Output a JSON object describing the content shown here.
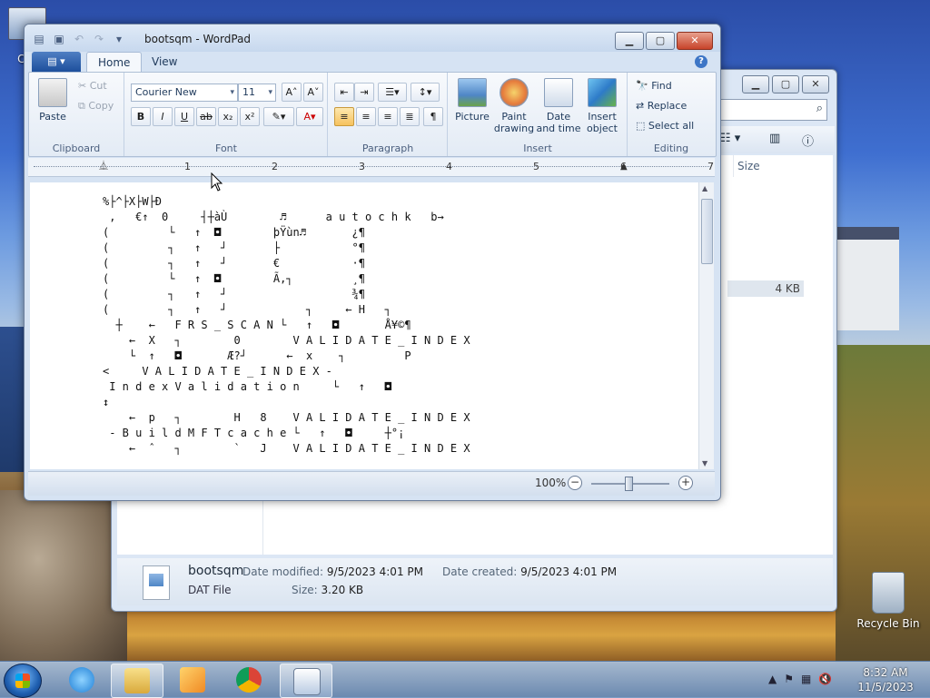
{
  "desktop": {
    "computer_label": "Co",
    "recycle_label": "Recycle Bin"
  },
  "explorer": {
    "column_size": "Size",
    "row_size": "4 KB",
    "search_icon": "search-icon",
    "details": {
      "file_name": "bootsqm",
      "file_type": "DAT File",
      "date_modified_label": "Date modified:",
      "date_modified_value": "9/5/2023 4:01 PM",
      "date_created_label": "Date created:",
      "date_created_value": "9/5/2023 4:01 PM",
      "size_label": "Size:",
      "size_value": "3.20 KB"
    }
  },
  "wordpad": {
    "title": "bootsqm - WordPad",
    "tabs": [
      "Home",
      "View"
    ],
    "clipboard": {
      "paste": "Paste",
      "cut": "Cut",
      "copy": "Copy",
      "label": "Clipboard"
    },
    "font": {
      "family": "Courier New",
      "size": "11",
      "label": "Font"
    },
    "paragraph": {
      "label": "Paragraph"
    },
    "insert": {
      "picture": "Picture",
      "paint": "Paint drawing",
      "datetime": "Date and time",
      "object": "Insert object",
      "label": "Insert"
    },
    "editing": {
      "find": "Find",
      "replace": "Replace",
      "select_all": "Select all",
      "label": "Editing"
    },
    "ruler_ticks": [
      "1",
      "2",
      "3",
      "4",
      "5",
      "6",
      "7"
    ],
    "zoom": "100%",
    "document_lines": [
      "%├^├X├W├Ð",
      " ,   €↑  0     ┤┼àÙ        ♬      a u t o c h k   b→",
      "(         └   ↑  ◘        þŸùn♬       ¿¶",
      "(         ┐   ↑   ┘       ├           °¶",
      "(         ┐   ↑   ┘       €           ·¶",
      "(         └   ↑  ◘        Ã,┐         ¸¶",
      "(         ┐   ↑   ┘                   ¾¶",
      "(         ┐   ↑   ┘            ┐     ← H   ┐",
      "  ┼    ←   F R S _ S C A N └   ↑   ◘       Å¥©¶",
      "    ←  X   ┐        0        V A L I D A T E _ I N D E X",
      "    └  ↑   ◘       Æ?┘      ←  x    ┐         P",
      "<     V A L I D A T E _ I N D E X -",
      " I n d e x V a l i d a t i o n     └   ↑   ◘",
      "↕",
      "    ←  p   ┐        H   8    V A L I D A T E _ I N D E X",
      " - B u i l d M F T c a c h e └   ↑   ◘     ┼°¡",
      "    ←  ˆ   ┐        `   J    V A L I D A T E _ I N D E X",
      " _"
    ]
  },
  "taskbar": {
    "time": "8:32 AM",
    "date": "11/5/2023"
  }
}
